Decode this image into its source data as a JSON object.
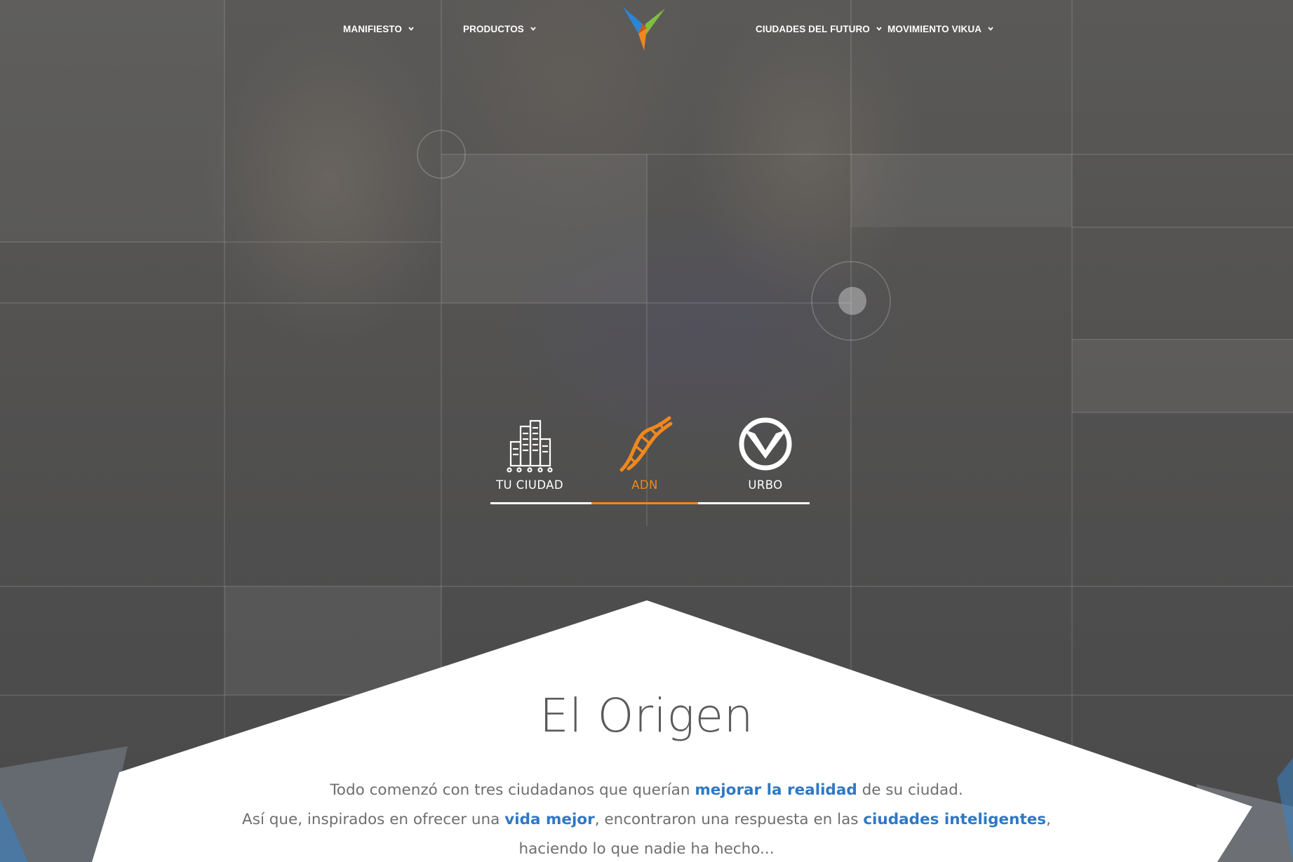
{
  "nav": {
    "left": [
      {
        "label": "MANIFIESTO"
      },
      {
        "label": "PRODUCTOS"
      }
    ],
    "right": [
      {
        "label": "CIUDADES DEL FUTURO"
      },
      {
        "label": "MOVIMIENTO VIKUA"
      }
    ],
    "logo_colors": {
      "blue": "#2a86d6",
      "green": "#7fbf3f",
      "orange": "#f0881e"
    }
  },
  "tabs": [
    {
      "label": "TU CIUDAD",
      "icon": "city-icon",
      "active": false
    },
    {
      "label": "ADN",
      "icon": "dna-icon",
      "active": true
    },
    {
      "label": "URBO",
      "icon": "urbo-logo-icon",
      "active": false
    }
  ],
  "section": {
    "title": "El Origen",
    "line1_a": "Todo comenzó con tres ciudadanos que querían ",
    "line1_hl": "mejorar la realidad",
    "line1_b": " de su ciudad.",
    "line2_a": "Así que, inspirados en ofrecer una ",
    "line2_hl1": "vida mejor",
    "line2_b": ", encontraron una respuesta en las ",
    "line2_hl2": "ciudades inteligentes",
    "line2_c": ",",
    "line3": "haciendo lo que nadie ha hecho..."
  },
  "colors": {
    "accent_orange": "#f0881e",
    "link_blue": "#2f78c4",
    "text_grey": "#6e6e6e",
    "title_grey": "#5a5a5a"
  }
}
